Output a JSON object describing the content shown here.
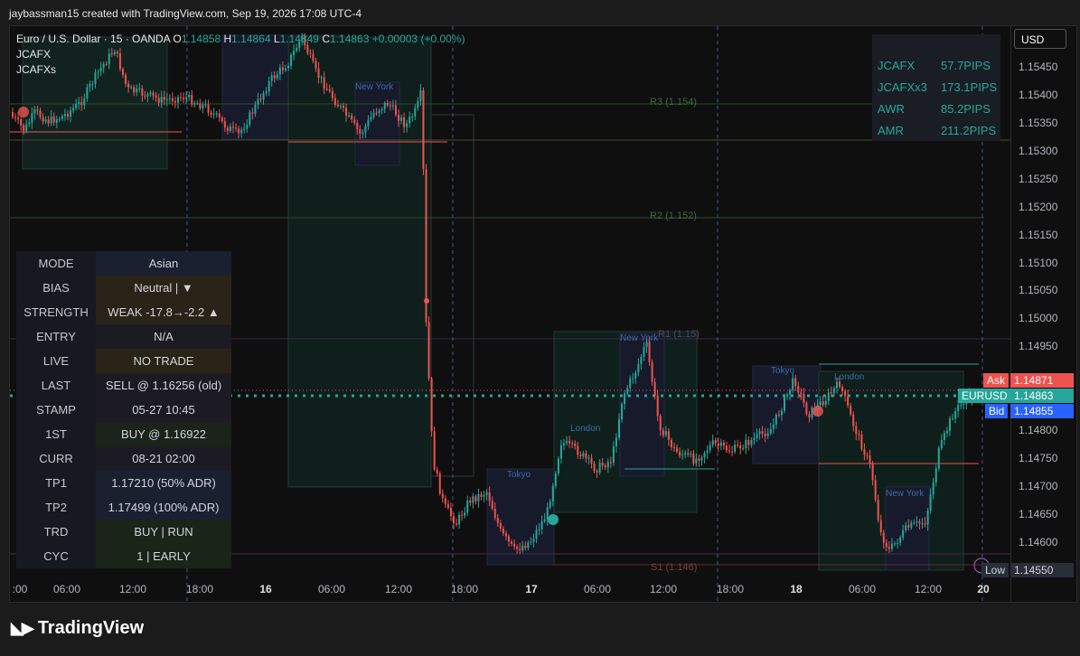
{
  "header": {
    "text": "jaybassman15 created with TradingView.com, Sep 19, 2026 17:08 UTC-4"
  },
  "legend": {
    "symbol": "Euro / U.S. Dollar · 15 · OANDA",
    "o_label": "O",
    "o": "1.14858",
    "h_label": "H",
    "h": "1.14864",
    "l_label": "L",
    "l": "1.14849",
    "c_label": "C",
    "c": "1.14863",
    "change": "+0.00003 (+0.00%)",
    "ind1": "JCAFX",
    "ind2": "JCAFXs"
  },
  "currency_button": "USD",
  "side_panel": [
    {
      "name": "JCAFX",
      "value": "57.7PIPS"
    },
    {
      "name": "JCAFXx3",
      "value": "173.1PIPS"
    },
    {
      "name": "AWR",
      "value": "85.2PIPS"
    },
    {
      "name": "AMR",
      "value": "211.2PIPS"
    }
  ],
  "info_table": [
    {
      "key": "MODE",
      "value": "Asian",
      "bg": "#1b2030"
    },
    {
      "key": "BIAS",
      "value": "Neutral | ▼",
      "bg": "#2a2418"
    },
    {
      "key": "STRENGTH",
      "value": "WEAK -17.8→-2.2 ▲",
      "bg": "#2a2418"
    },
    {
      "key": "ENTRY",
      "value": "N/A",
      "bg": "#1c1b24"
    },
    {
      "key": "LIVE",
      "value": "NO TRADE",
      "bg": "#2a2418"
    },
    {
      "key": "LAST",
      "value": "SELL @ 1.16256 (old)",
      "bg": "#1c1b24"
    },
    {
      "key": "STAMP",
      "value": "05-27 10:45",
      "bg": "#1c1b24"
    },
    {
      "key": "1ST",
      "value": "BUY @ 1.16922",
      "bg": "#1a2418"
    },
    {
      "key": "CURR",
      "value": "08-21 02:00",
      "bg": "#1c1b24"
    },
    {
      "key": "TP1",
      "value": "1.17210  (50% ADR)",
      "bg": "#1b2030"
    },
    {
      "key": "TP2",
      "value": "1.17499  (100% ADR)",
      "bg": "#1b2030"
    },
    {
      "key": "TRD",
      "value": "BUY | RUN",
      "bg": "#1a2418"
    },
    {
      "key": "CYC",
      "value": "1 | EARLY",
      "bg": "#1a2418"
    }
  ],
  "price_axis": [
    "1.15450",
    "1.15400",
    "1.15350",
    "1.15300",
    "1.15250",
    "1.15200",
    "1.15150",
    "1.15100",
    "1.15050",
    "1.15000",
    "1.14950",
    "1.14800",
    "1.14750",
    "1.14700",
    "1.14650",
    "1.14600"
  ],
  "time_axis": [
    {
      "label": ":00",
      "bold": false
    },
    {
      "label": "06:00",
      "bold": false
    },
    {
      "label": "12:00",
      "bold": false
    },
    {
      "label": "18:00",
      "bold": false
    },
    {
      "label": "16",
      "bold": true
    },
    {
      "label": "06:00",
      "bold": false
    },
    {
      "label": "12:00",
      "bold": false
    },
    {
      "label": "18:00",
      "bold": false
    },
    {
      "label": "17",
      "bold": true
    },
    {
      "label": "06:00",
      "bold": false
    },
    {
      "label": "12:00",
      "bold": false
    },
    {
      "label": "18:00",
      "bold": false
    },
    {
      "label": "18",
      "bold": true
    },
    {
      "label": "06:00",
      "bold": false
    },
    {
      "label": "12:00",
      "bold": false
    },
    {
      "label": "20",
      "bold": true
    }
  ],
  "price_tags": {
    "ask_label": "Ask",
    "ask": "1.14871",
    "symbol_label": "EURUSD",
    "last": "1.14863",
    "bid_label": "Bid",
    "bid": "1.14855",
    "low_label": "Low",
    "low": "1.14550"
  },
  "levels": {
    "r3": "R3 (1.154)",
    "r2": "R2 (1.152)",
    "r1": "R1 (1.15)",
    "s1": "S1 (1.146)"
  },
  "sessions": {
    "tokyo": "Tokyo",
    "london": "London",
    "new_york": "New York"
  },
  "brand": "TradingView",
  "colors": {
    "up": "#26a69a",
    "down": "#ef5350",
    "bid": "#2962ff",
    "panel_text": "#26a69a"
  }
}
